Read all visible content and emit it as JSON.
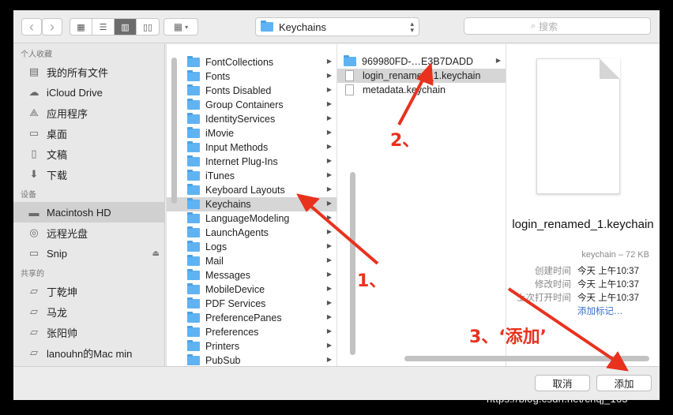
{
  "toolbar": {
    "back": "‹",
    "forward": "›",
    "path": "Keychains",
    "search_placeholder": "搜索"
  },
  "sidebar": {
    "sections": [
      {
        "header": "个人收藏",
        "items": [
          {
            "label": "我的所有文件",
            "icon": "all-files-icon"
          },
          {
            "label": "iCloud Drive",
            "icon": "cloud-icon"
          },
          {
            "label": "应用程序",
            "icon": "applications-icon"
          },
          {
            "label": "桌面",
            "icon": "desktop-icon"
          },
          {
            "label": "文稿",
            "icon": "documents-icon"
          },
          {
            "label": "下载",
            "icon": "downloads-icon"
          }
        ]
      },
      {
        "header": "设备",
        "items": [
          {
            "label": "Macintosh HD",
            "icon": "harddisk-icon",
            "selected": true
          },
          {
            "label": "远程光盘",
            "icon": "disc-icon"
          },
          {
            "label": "Snip",
            "icon": "drive-icon",
            "eject": true
          }
        ]
      },
      {
        "header": "共享的",
        "items": [
          {
            "label": "丁乾坤",
            "icon": "shared-computer-icon"
          },
          {
            "label": "马龙",
            "icon": "shared-computer-icon"
          },
          {
            "label": "张阳帅",
            "icon": "shared-computer-icon"
          },
          {
            "label": "lanouhn的Mac min",
            "icon": "shared-computer-icon"
          }
        ]
      }
    ]
  },
  "column1": [
    "FontCollections",
    "Fonts",
    "Fonts Disabled",
    "Group Containers",
    "IdentityServices",
    "iMovie",
    "Input Methods",
    "Internet Plug-Ins",
    "iTunes",
    "Keyboard Layouts",
    "Keychains",
    "LanguageModeling",
    "LaunchAgents",
    "Logs",
    "Mail",
    "Messages",
    "MobileDevice",
    "PDF Services",
    "PreferencePanes",
    "Preferences",
    "Printers",
    "PubSub"
  ],
  "column1_selected": "Keychains",
  "column2": [
    {
      "label": "969980FD-…E3B7DADD",
      "type": "folder"
    },
    {
      "label": "login_renamed_1.keychain",
      "type": "file",
      "selected": true
    },
    {
      "label": "metadata.keychain",
      "type": "file"
    }
  ],
  "preview": {
    "name": "login_renamed_1.keychain",
    "kind": "keychain – 72 KB",
    "fields": [
      {
        "key": "创建时间",
        "value": "今天 上午10:37"
      },
      {
        "key": "修改时间",
        "value": "今天 上午10:37"
      },
      {
        "key": "上次打开时间",
        "value": "今天 上午10:37"
      }
    ],
    "add_tags": "添加标记…"
  },
  "buttons": {
    "cancel": "取消",
    "add": "添加"
  },
  "annotations": {
    "step1": "1、",
    "step2": "2、",
    "step3": "3、‘添加’"
  },
  "watermark": "https://blog.csdn.net/chqj_163",
  "colors": {
    "folder": "#5fb3f2",
    "annotation": "#e8321e",
    "selection": "#d6d6d6"
  }
}
